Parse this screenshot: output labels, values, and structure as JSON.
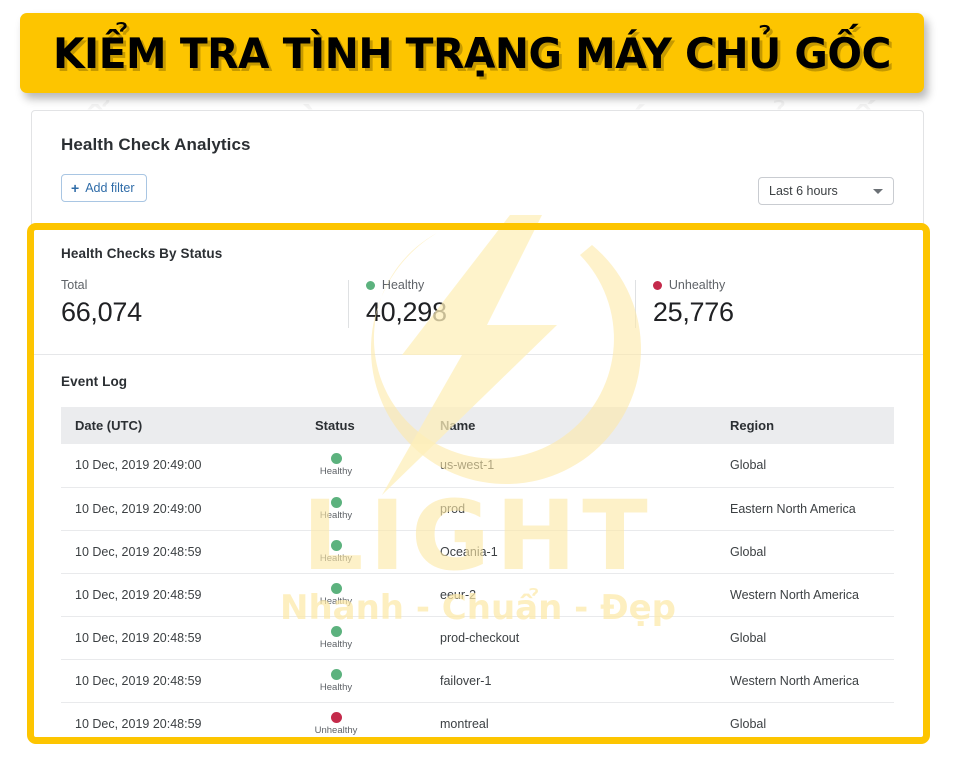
{
  "banner": {
    "text": "KIỂM TRA TÌNH TRẠNG MÁY CHỦ GỐC",
    "bg_color": "#FDC500",
    "text_color": "#000000"
  },
  "card": {
    "title": "Health Check Analytics",
    "add_filter_label": "Add filter",
    "add_filter_icon": "plus-icon",
    "time_range": {
      "value": "Last 6 hours",
      "icon": "chevron-down-icon"
    }
  },
  "status_section": {
    "title": "Health Checks By Status",
    "stats": [
      {
        "label": "Total",
        "value": "66,074",
        "dot": false,
        "color": ""
      },
      {
        "label": "Healthy",
        "value": "40,298",
        "dot": true,
        "color": "#5cb27e"
      },
      {
        "label": "Unhealthy",
        "value": "25,776",
        "dot": true,
        "color": "#c42a4b"
      }
    ]
  },
  "event_log": {
    "title": "Event Log",
    "columns": [
      "Date (UTC)",
      "Status",
      "Name",
      "Region"
    ],
    "rows": [
      {
        "date": "10 Dec, 2019 20:49:00",
        "status": "Healthy",
        "status_color": "#5cb27e",
        "name": "us-west-1",
        "region": "Global"
      },
      {
        "date": "10 Dec, 2019 20:49:00",
        "status": "Healthy",
        "status_color": "#5cb27e",
        "name": "prod",
        "region": "Eastern North America"
      },
      {
        "date": "10 Dec, 2019 20:48:59",
        "status": "Healthy",
        "status_color": "#5cb27e",
        "name": "Oceania-1",
        "region": "Global"
      },
      {
        "date": "10 Dec, 2019 20:48:59",
        "status": "Healthy",
        "status_color": "#5cb27e",
        "name": "eeur-2",
        "region": "Western North America"
      },
      {
        "date": "10 Dec, 2019 20:48:59",
        "status": "Healthy",
        "status_color": "#5cb27e",
        "name": "prod-checkout",
        "region": "Global"
      },
      {
        "date": "10 Dec, 2019 20:48:59",
        "status": "Healthy",
        "status_color": "#5cb27e",
        "name": "failover-1",
        "region": "Western North America"
      },
      {
        "date": "10 Dec, 2019 20:48:59",
        "status": "Unhealthy",
        "status_color": "#c42a4b",
        "name": "montreal",
        "region": "Global"
      }
    ]
  },
  "watermark": {
    "brand": "LIGHT",
    "tagline": "Nhanh - Chuẩn - Đẹp",
    "logo": "lightning-bolt-icon",
    "color": "#FDE9A8"
  },
  "highlight": {
    "color": "#FDC500"
  }
}
